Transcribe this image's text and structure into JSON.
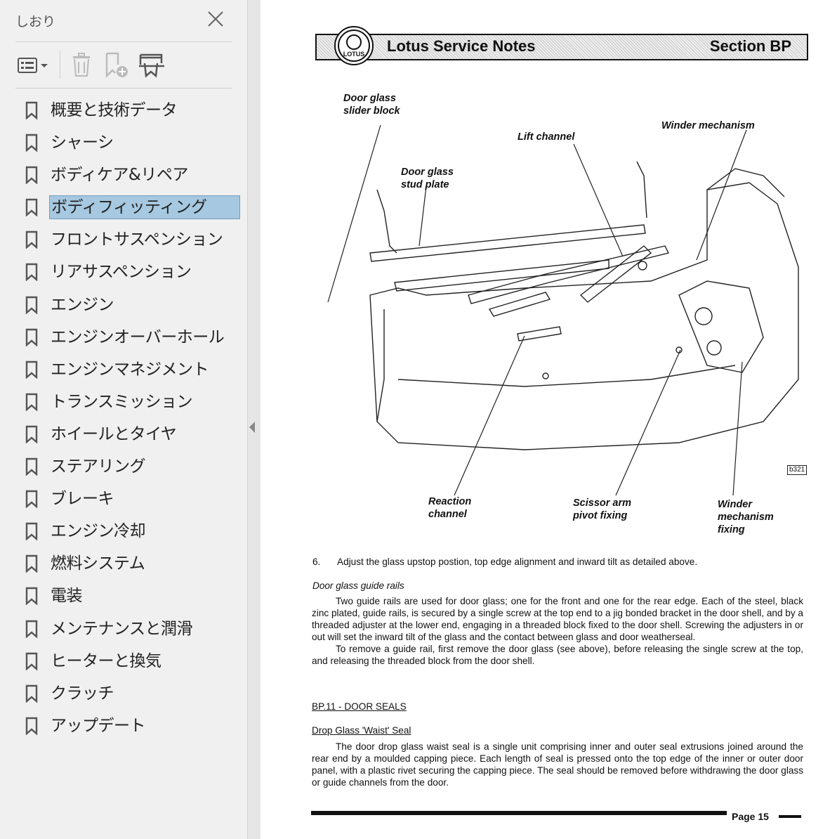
{
  "sidebar": {
    "title": "しおり",
    "toolbar": {
      "options_icon": "list-options-icon",
      "delete_icon": "trash-icon",
      "add_icon": "add-bookmark-icon",
      "search_icon": "find-bookmark-icon"
    },
    "items": [
      {
        "label": "概要と技術データ"
      },
      {
        "label": "シャーシ"
      },
      {
        "label": "ボディケア&リペア"
      },
      {
        "label": "ボディフィッティング",
        "selected": true
      },
      {
        "label": "フロントサスペンション"
      },
      {
        "label": "リアサスペンション"
      },
      {
        "label": "エンジン"
      },
      {
        "label": "エンジンオーバーホール"
      },
      {
        "label": "エンジンマネジメント"
      },
      {
        "label": "トランスミッション"
      },
      {
        "label": "ホイールとタイヤ"
      },
      {
        "label": "ステアリング"
      },
      {
        "label": "ブレーキ"
      },
      {
        "label": "エンジン冷却"
      },
      {
        "label": "燃料システム"
      },
      {
        "label": "電装"
      },
      {
        "label": "メンテナンスと潤滑"
      },
      {
        "label": "ヒーターと換気"
      },
      {
        "label": "クラッチ"
      },
      {
        "label": "アップデート"
      }
    ],
    "selected_color": "#a6c8e0"
  },
  "document": {
    "header": {
      "left": "Lotus Service Notes",
      "right": "Section BP",
      "logo_text": "LOTUS"
    },
    "figure": {
      "callouts": {
        "slider_block": "Door glass\nslider block",
        "lift_channel": "Lift channel",
        "winder_mechanism": "Winder mechanism",
        "stud_plate": "Door glass\nstud plate",
        "reaction_channel": "Reaction\nchannel",
        "scissor_pivot": "Scissor arm\npivot fixing",
        "winder_fixing": "Winder\nmechanism\nfixing"
      },
      "id": "b321"
    },
    "step6": {
      "num": "6.",
      "text": "Adjust the glass upstop postion, top edge alignment and inward tilt as detailed above."
    },
    "guide_rails": {
      "heading": "Door glass guide rails",
      "p1": "Two guide rails are used for door glass; one for the front and one for the rear edge.  Each of the steel, black zinc plated, guide rails, is secured by a single screw at the top end to a jig bonded bracket in the door shell, and by a threaded adjuster at the lower end, engaging in a threaded block fixed to the door shell. Screwing the adjusters in or out will set the inward tilt of the glass and the contact between glass and door weatherseal.",
      "p2": "To remove a guide rail, first remove the door glass (see above), before releasing the single screw at the top, and releasing the threaded block from the door shell."
    },
    "seals": {
      "section": "BP.11 - DOOR SEALS",
      "subheading": "Drop Glass 'Waist' Seal",
      "p1": "The door drop glass waist seal is a single unit comprising inner and outer seal extrusions joined around the rear end by a moulded capping piece.  Each length of seal is pressed onto the top edge of the inner or outer door panel, with a plastic rivet securing the capping piece.  The seal should be removed before withdrawing the door glass or guide channels from the door."
    },
    "footer": {
      "page": "Page 15"
    }
  }
}
